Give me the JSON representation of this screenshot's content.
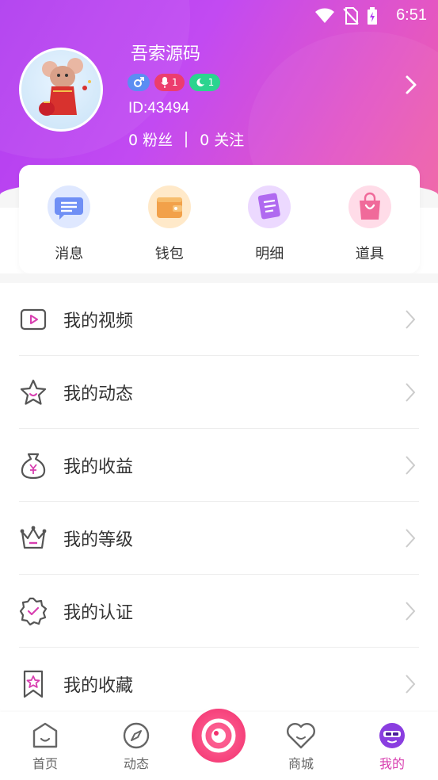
{
  "status": {
    "time": "6:51"
  },
  "profile": {
    "username": "吾索源码",
    "badges": [
      {
        "type": "gender",
        "icon": "male-icon",
        "color": "#5b8df2"
      },
      {
        "type": "mic",
        "icon": "mic-icon",
        "value": "1",
        "color": "#ec3d6e"
      },
      {
        "type": "moon",
        "icon": "moon-icon",
        "value": "1",
        "color": "#2bd48f"
      }
    ],
    "id_text": "ID:43494",
    "fans": "0 粉丝",
    "following": "0 关注"
  },
  "quick": [
    {
      "label": "消息",
      "icon": "message-icon",
      "color": "#6f8ff5"
    },
    {
      "label": "钱包",
      "icon": "wallet-icon",
      "color": "#f2a14a"
    },
    {
      "label": "明细",
      "icon": "detail-icon",
      "color": "#b06af0"
    },
    {
      "label": "道具",
      "icon": "bag-icon",
      "color": "#f06a9a"
    }
  ],
  "menu": [
    {
      "label": "我的视频",
      "icon": "video-icon"
    },
    {
      "label": "我的动态",
      "icon": "star-icon"
    },
    {
      "label": "我的收益",
      "icon": "money-bag-icon"
    },
    {
      "label": "我的等级",
      "icon": "crown-icon"
    },
    {
      "label": "我的认证",
      "icon": "verified-badge-icon"
    },
    {
      "label": "我的收藏",
      "icon": "bookmark-star-icon"
    }
  ],
  "nav": [
    {
      "label": "首页",
      "icon": "home-icon"
    },
    {
      "label": "动态",
      "icon": "compass-icon"
    },
    {
      "label": "商城",
      "icon": "heart-icon"
    },
    {
      "label": "我的",
      "icon": "profile-face-icon",
      "active": true
    }
  ],
  "colors": {
    "accent": "#d83fb0",
    "header_start": "#b03cf0",
    "header_end": "#f062a4"
  }
}
